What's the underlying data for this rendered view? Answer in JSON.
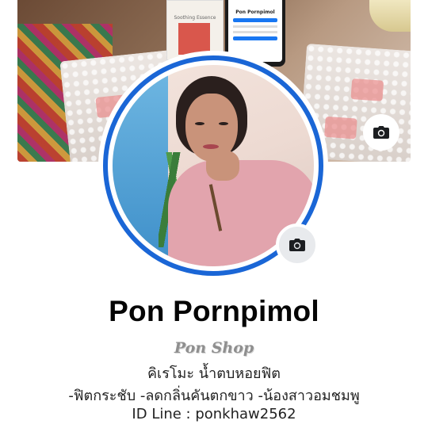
{
  "profile": {
    "name": "Pon Pornpimol",
    "shop": "Pon Shop",
    "bio_line_1": "คิเรโมะ น้ำตบหอยฟิต",
    "bio_line_2": "-ฟิตกระชับ -ลดกลิ่นคันตกขาว -น้องสาวอมชมพู",
    "bio_line_3": "ID Line : ponkhaw2562"
  },
  "cover": {
    "product_label": "Soothing Essence",
    "phone_profile_name": "Pon Pornpimol"
  },
  "icons": {
    "cover_camera": "camera-icon",
    "avatar_camera": "camera-icon"
  },
  "colors": {
    "avatar_ring": "#1a66d6",
    "name_text": "#050505",
    "shop_text": "#8f8f8f"
  }
}
